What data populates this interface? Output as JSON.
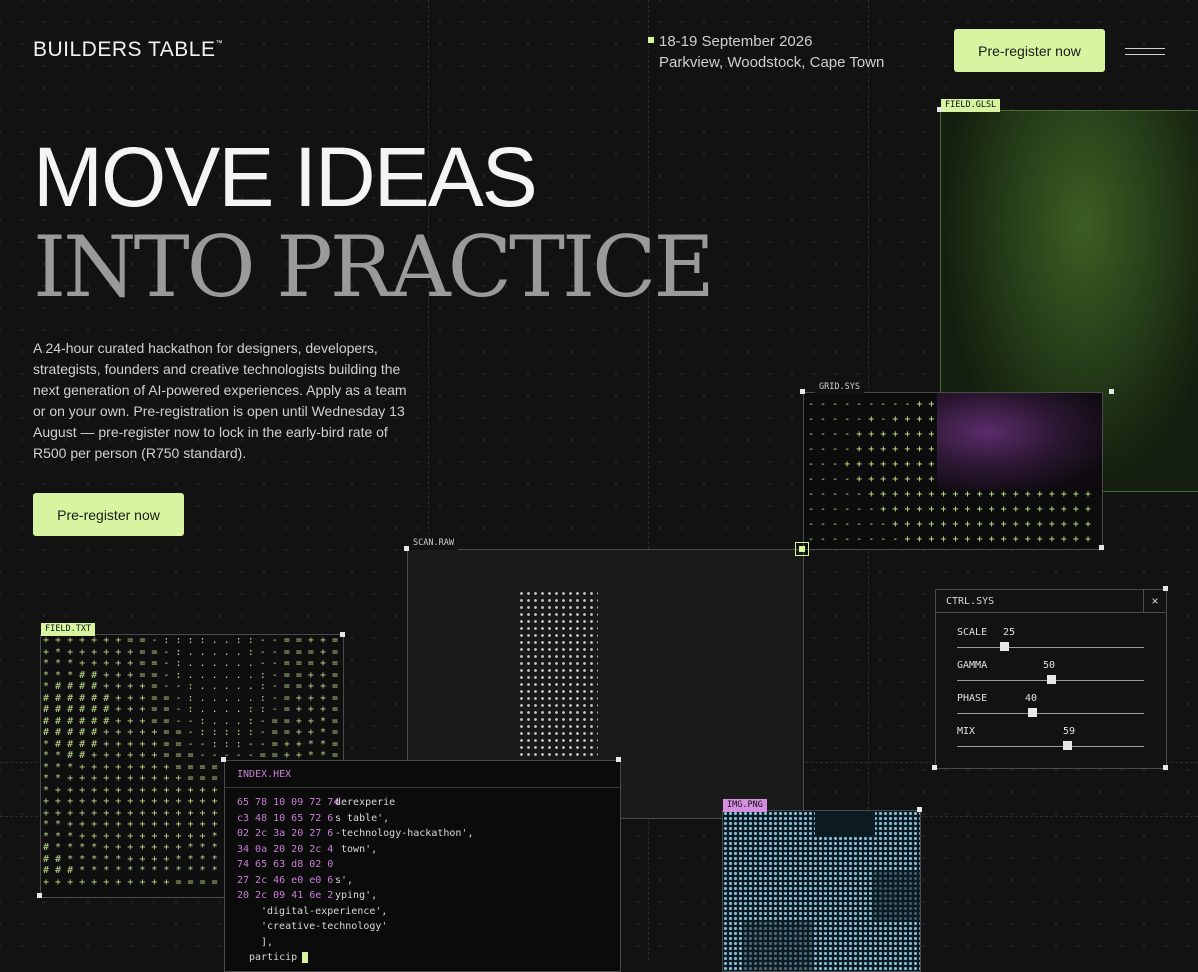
{
  "header": {
    "logo": "BUILDERS TABLE",
    "logo_mark": "™",
    "event_date": "18-19 September 2026",
    "event_location": "Parkview, Woodstock, Cape Town",
    "cta_label": "Pre-register now",
    "menu_icon": "hamburger-menu-icon"
  },
  "hero": {
    "line1": "MOVE IDEAS",
    "line2": "INTO PRACTICE",
    "intro": "A 24-hour curated hackathon for designers, developers, strategists, founders and creative technologists building the next generation of AI-powered experiences. Apply as a team or on your own. Pre-registration is open until Wednesday 13 August — pre-register now to lock in the early-bird rate of R500 per person (R750 standard).",
    "cta_label": "Pre-register now"
  },
  "panels": {
    "glsl_label": "FIELD.GLSL",
    "grid_label": "GRID.SYS",
    "scan_label": "SCAN.RAW",
    "fieldtxt_label": "FIELD.TXT",
    "img_label": "IMG.PNG",
    "hex": {
      "label": "INDEX.HEX",
      "lines": [
        {
          "hex": "65 78 10 09 72 74",
          "text": "derexperie"
        },
        {
          "hex": "c3 48 10 65 72 6",
          "text": "s table',"
        },
        {
          "hex": "02 2c 3a 20 27 6",
          "text": "-technology-hackathon',"
        },
        {
          "hex": "34 0a 20 20 2c 4",
          "text": " town',"
        },
        {
          "hex": "74 65 63 d8 02 0",
          "text": ""
        },
        {
          "hex": "27 2c 46 e0 e0 6",
          "text": "s',"
        },
        {
          "hex": "20 2c 09 41 6e 2",
          "text": "yping',"
        },
        {
          "hex": "",
          "text": "'digital-experience',"
        },
        {
          "hex": "",
          "text": "'creative-technology'"
        },
        {
          "hex": "",
          "text": "],"
        },
        {
          "hex": "",
          "text": "particip"
        }
      ]
    },
    "ctrl": {
      "label": "CTRL.SYS",
      "close": "×",
      "sliders": [
        {
          "name": "SCALE",
          "value": "25",
          "level": 0.25
        },
        {
          "name": "GAMMA",
          "value": "50",
          "level": 0.5
        },
        {
          "name": "PHASE",
          "value": "40",
          "level": 0.4
        },
        {
          "name": "MIX",
          "value": "59",
          "level": 0.59
        }
      ]
    }
  },
  "colors": {
    "accent": "#d7f5a0",
    "pink": "#c77fd3",
    "background": "#121212",
    "cyan": "#9ad6f2"
  }
}
